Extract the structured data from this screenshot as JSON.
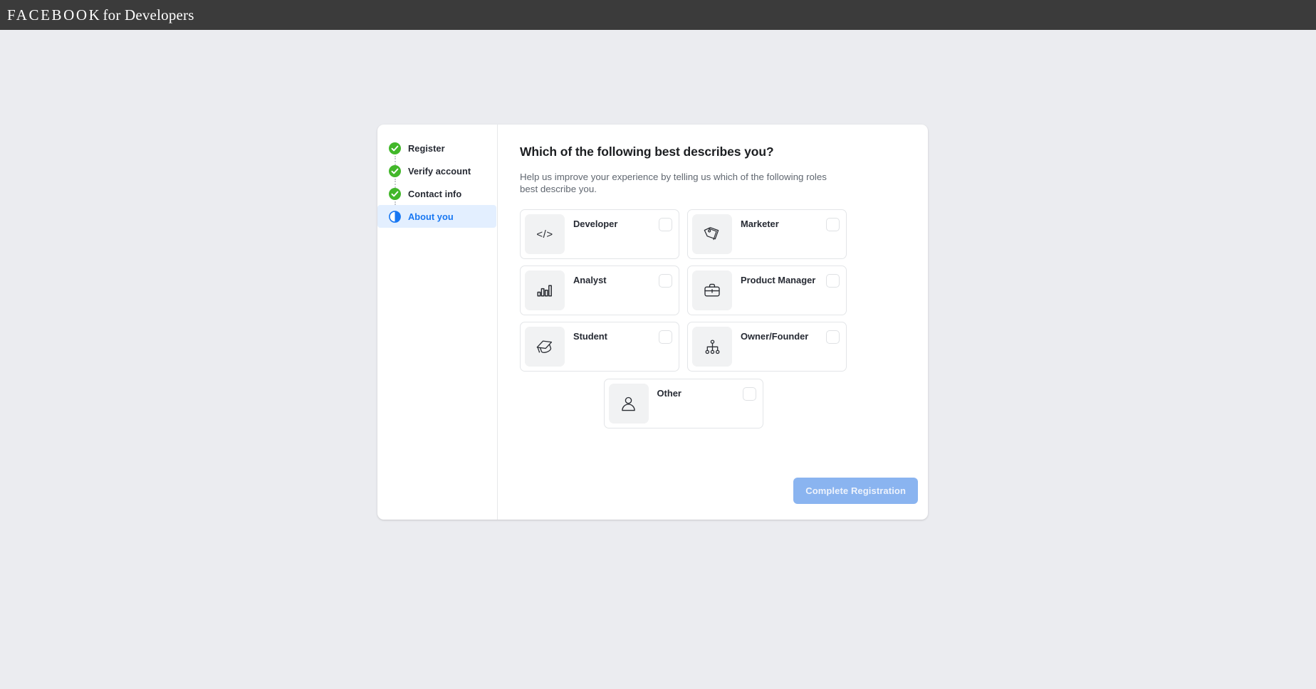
{
  "topbar": {
    "brand_primary": "FACEBOOK",
    "brand_secondary": "for Developers",
    "background_color": "#3b3b3b"
  },
  "page": {
    "background_color": "#ebecf0"
  },
  "sidebar": {
    "steps": [
      {
        "label": "Register",
        "state": "complete",
        "icon": "check-circle-icon"
      },
      {
        "label": "Verify account",
        "state": "complete",
        "icon": "check-circle-icon"
      },
      {
        "label": "Contact info",
        "state": "complete",
        "icon": "check-circle-icon"
      },
      {
        "label": "About you",
        "state": "current",
        "icon": "half-circle-icon"
      }
    ],
    "complete_color": "#42b72a",
    "current_color": "#1877f2",
    "current_bg_color": "#e3efff"
  },
  "main": {
    "heading": "Which of the following best describes you?",
    "subheading": "Help us improve your experience by telling us which of the following roles best describe you.",
    "roles": [
      {
        "label": "Developer",
        "icon": "code-icon",
        "checked": false
      },
      {
        "label": "Marketer",
        "icon": "tag-icon",
        "checked": false
      },
      {
        "label": "Analyst",
        "icon": "bar-chart-icon",
        "checked": false
      },
      {
        "label": "Product Manager",
        "icon": "briefcase-icon",
        "checked": false
      },
      {
        "label": "Student",
        "icon": "graduation-cap-icon",
        "checked": false
      },
      {
        "label": "Owner/Founder",
        "icon": "org-chart-icon",
        "checked": false
      },
      {
        "label": "Other",
        "icon": "person-icon",
        "checked": false
      }
    ],
    "submit_label": "Complete Registration",
    "submit_enabled": false,
    "submit_color": "#8ab4f0"
  }
}
